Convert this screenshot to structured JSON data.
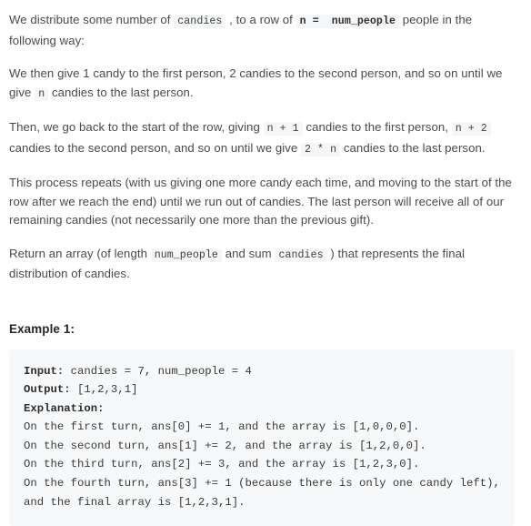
{
  "document": {
    "paragraphs": [
      {
        "id": "intro",
        "parts": [
          {
            "type": "text",
            "value": "We distribute some number of "
          },
          {
            "type": "code",
            "value": "candies",
            "bold": false
          },
          {
            "type": "text",
            "value": ", to a row of "
          },
          {
            "type": "code",
            "value": "n =  num_people",
            "bold": true
          },
          {
            "type": "text",
            "value": " people in the following way:"
          }
        ]
      },
      {
        "id": "first-pass",
        "parts": [
          {
            "type": "text",
            "value": "We then give 1 candy to the first person, 2 candies to the second person, and so on until we give "
          },
          {
            "type": "code",
            "value": "n",
            "bold": false
          },
          {
            "type": "text",
            "value": " candies to the last person."
          }
        ]
      },
      {
        "id": "second-pass",
        "parts": [
          {
            "type": "text",
            "value": "Then, we go back to the start of the row, giving "
          },
          {
            "type": "code",
            "value": "n + 1",
            "bold": false
          },
          {
            "type": "text",
            "value": " candies to the first person, "
          },
          {
            "type": "code",
            "value": "n + 2",
            "bold": false
          },
          {
            "type": "text",
            "value": " candies to the second person, and so on until we give "
          },
          {
            "type": "code",
            "value": "2 * n",
            "bold": false
          },
          {
            "type": "text",
            "value": " candies to the last person."
          }
        ]
      },
      {
        "id": "repeat-rule",
        "parts": [
          {
            "type": "text",
            "value": "This process repeats (with us giving one more candy each time, and moving to the start of the row after we reach the end) until we run out of candies.  The last person will receive all of our remaining candies (not necessarily one more than the previous gift)."
          }
        ]
      },
      {
        "id": "return-spec",
        "parts": [
          {
            "type": "text",
            "value": "Return an array (of length "
          },
          {
            "type": "code",
            "value": "num_people",
            "bold": false
          },
          {
            "type": "text",
            "value": " and sum "
          },
          {
            "type": "code",
            "value": "candies",
            "bold": false
          },
          {
            "type": "text",
            "value": ") that represents the final distribution of candies."
          }
        ]
      }
    ],
    "example": {
      "title": "Example 1:",
      "lines": [
        {
          "label": "Input:",
          "rest": " candies = 7, num_people = 4"
        },
        {
          "label": "Output:",
          "rest": " [1,2,3,1]"
        },
        {
          "label": "Explanation:",
          "rest": ""
        },
        {
          "label": "",
          "rest": "On the first turn, ans[0] += 1, and the array is [1,0,0,0]."
        },
        {
          "label": "",
          "rest": "On the second turn, ans[1] += 2, and the array is [1,2,0,0]."
        },
        {
          "label": "",
          "rest": "On the third turn, ans[2] += 3, and the array is [1,2,3,0]."
        },
        {
          "label": "",
          "rest": "On the fourth turn, ans[3] += 1 (because there is only one candy left),"
        },
        {
          "label": "",
          "rest": "and the final array is [1,2,3,1]."
        }
      ]
    }
  },
  "colors": {
    "body_text": "#4a4a4a",
    "heading_text": "#262626",
    "inline_code_bg": "#f5f6f7",
    "code_block_bg": "#f7f8f9",
    "code_text": "#3a3a3a",
    "page_bg": "#ffffff"
  }
}
